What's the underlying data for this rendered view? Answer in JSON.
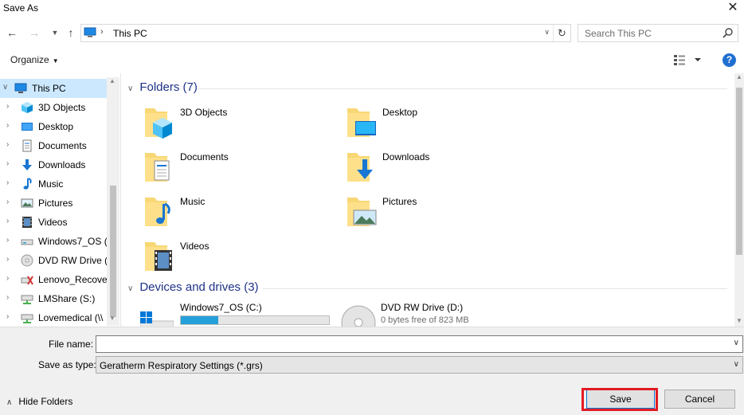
{
  "window": {
    "title": "Save As",
    "close_glyph": "✕"
  },
  "nav": {
    "back_icon": "arrow-left-icon",
    "forward_icon": "arrow-right-icon",
    "up_icon": "arrow-up-icon",
    "address_path": "This PC",
    "search_placeholder": "Search This PC"
  },
  "toolbar": {
    "organize_label": "Organize",
    "help_label": "?"
  },
  "tree": {
    "root": "This PC",
    "items": [
      {
        "label": "3D Objects",
        "icon": "cube-icon"
      },
      {
        "label": "Desktop",
        "icon": "desktop-icon"
      },
      {
        "label": "Documents",
        "icon": "document-icon"
      },
      {
        "label": "Downloads",
        "icon": "download-arrow-icon"
      },
      {
        "label": "Music",
        "icon": "music-note-icon"
      },
      {
        "label": "Pictures",
        "icon": "picture-icon"
      },
      {
        "label": "Videos",
        "icon": "film-icon"
      },
      {
        "label": "Windows7_OS (C",
        "icon": "drive-icon"
      },
      {
        "label": "DVD RW Drive (D",
        "icon": "disc-icon"
      },
      {
        "label": "Lenovo_Recover",
        "icon": "recovery-drive-icon"
      },
      {
        "label": "LMShare (S:)",
        "icon": "network-drive-icon"
      },
      {
        "label": "Lovemedical (\\\\",
        "icon": "network-drive-icon"
      }
    ]
  },
  "folders_group": {
    "header": "Folders (7)",
    "items": [
      {
        "label": "3D Objects",
        "overlay": "cube"
      },
      {
        "label": "Desktop",
        "overlay": "desktop"
      },
      {
        "label": "Documents",
        "overlay": "document"
      },
      {
        "label": "Downloads",
        "overlay": "download"
      },
      {
        "label": "Music",
        "overlay": "music"
      },
      {
        "label": "Pictures",
        "overlay": "picture"
      },
      {
        "label": "Videos",
        "overlay": "film"
      }
    ]
  },
  "drives_group": {
    "header": "Devices and drives (3)",
    "items": [
      {
        "label": "Windows7_OS (C:)",
        "used_fraction": 0.25
      },
      {
        "label": "DVD RW Drive (D:)",
        "free_text": "0 bytes free of 823 MB"
      }
    ]
  },
  "form": {
    "file_name_label": "File name:",
    "file_name_value": "",
    "save_as_type_label": "Save as type:",
    "save_as_type_value": "Geratherm Respiratory Settings (*.grs)",
    "hide_folders_label": "Hide Folders",
    "save_label": "Save",
    "cancel_label": "Cancel"
  },
  "colors": {
    "accent": "#0078d7",
    "highlight": "#cce8ff",
    "header_text": "#1e3287",
    "annotation": "#e21b23",
    "drive_fill": "#26a0da"
  }
}
